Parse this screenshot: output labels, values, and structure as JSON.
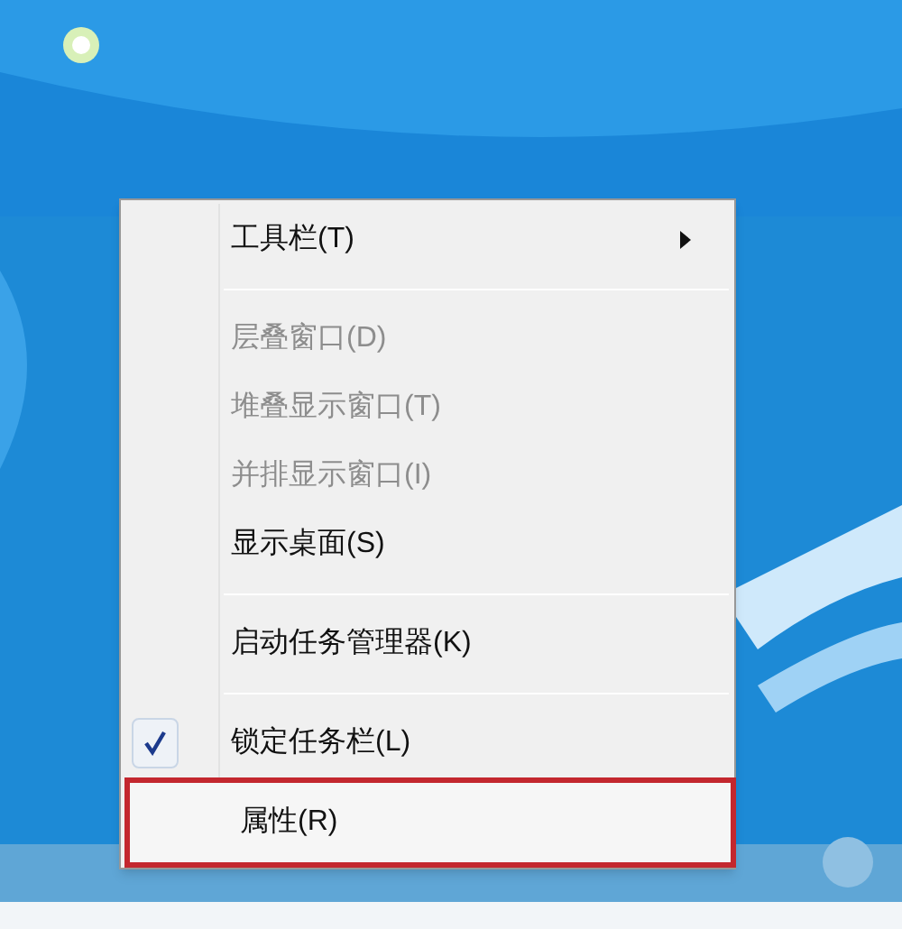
{
  "context_menu": {
    "items": [
      {
        "kind": "item",
        "label": "工具栏(T)",
        "submenu": true,
        "disabled": false,
        "checked": false,
        "annotated": false
      },
      {
        "kind": "separator"
      },
      {
        "kind": "item",
        "label": "层叠窗口(D)",
        "submenu": false,
        "disabled": true,
        "checked": false,
        "annotated": false
      },
      {
        "kind": "item",
        "label": "堆叠显示窗口(T)",
        "submenu": false,
        "disabled": true,
        "checked": false,
        "annotated": false
      },
      {
        "kind": "item",
        "label": "并排显示窗口(I)",
        "submenu": false,
        "disabled": true,
        "checked": false,
        "annotated": false
      },
      {
        "kind": "item",
        "label": "显示桌面(S)",
        "submenu": false,
        "disabled": false,
        "checked": false,
        "annotated": false
      },
      {
        "kind": "separator"
      },
      {
        "kind": "item",
        "label": "启动任务管理器(K)",
        "submenu": false,
        "disabled": false,
        "checked": false,
        "annotated": false
      },
      {
        "kind": "separator"
      },
      {
        "kind": "item",
        "label": "锁定任务栏(L)",
        "submenu": false,
        "disabled": false,
        "checked": true,
        "annotated": false
      },
      {
        "kind": "item",
        "label": "属性(R)",
        "submenu": false,
        "disabled": false,
        "checked": false,
        "annotated": true
      }
    ]
  }
}
